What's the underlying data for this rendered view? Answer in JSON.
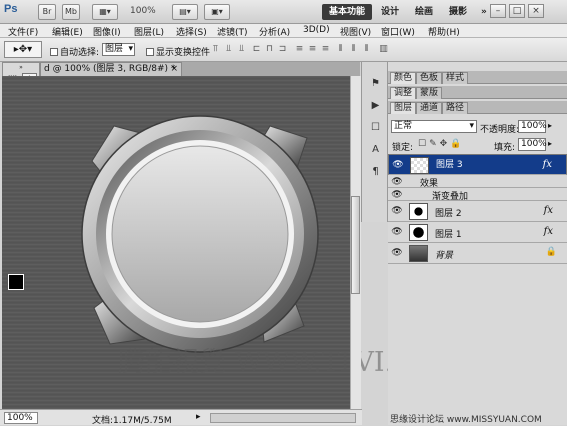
{
  "app": {
    "logo": "Ps",
    "bridge": "Br",
    "minibridge": "Mb",
    "zoom": "100%",
    "workspaces": [
      "基本功能",
      "设计",
      "绘画",
      "摄影"
    ],
    "more": "»"
  },
  "menu": [
    "文件(F)",
    "编辑(E)",
    "图像(I)",
    "图层(L)",
    "选择(S)",
    "滤镜(T)",
    "分析(A)",
    "3D(D)",
    "视图(V)",
    "窗口(W)",
    "帮助(H)"
  ],
  "options": {
    "auto_select_label": "自动选择:",
    "auto_select_value": "图层",
    "show_transform_label": "显示变换控件"
  },
  "document": {
    "tab_title": "d @ 100% (图层 3, RGB/8#) *",
    "tab_close": "×",
    "zoom": "100%",
    "doc_size": "文档:1.17M/5.75M",
    "watermark": "腾龍視覺 WWW.TLVI.NET"
  },
  "panels": {
    "row1_tabs": [
      "颜色",
      "色板",
      "样式"
    ],
    "row2_tabs": [
      "调整",
      "蒙版"
    ],
    "row3_tabs": [
      "图层",
      "通道",
      "路径"
    ],
    "blend_mode": "正常",
    "opacity_label": "不透明度:",
    "opacity_value": "100%",
    "lock_label": "锁定:",
    "fill_label": "填充:",
    "fill_value": "100%",
    "layers": [
      {
        "name": "图层 3",
        "fx": "fx",
        "selected": true
      },
      {
        "name": "效果",
        "effect_header": true
      },
      {
        "name": "渐变叠加",
        "effect": true
      },
      {
        "name": "图层 2",
        "fx": "fx"
      },
      {
        "name": "图层 1",
        "fx": "fx"
      },
      {
        "name": "背景",
        "locked": true
      }
    ]
  },
  "footer_credit": "思缘设计论坛 www.MISSYUAN.COM",
  "colors": {
    "selection": "#133c8a",
    "canvas": "#5a5a5a"
  }
}
